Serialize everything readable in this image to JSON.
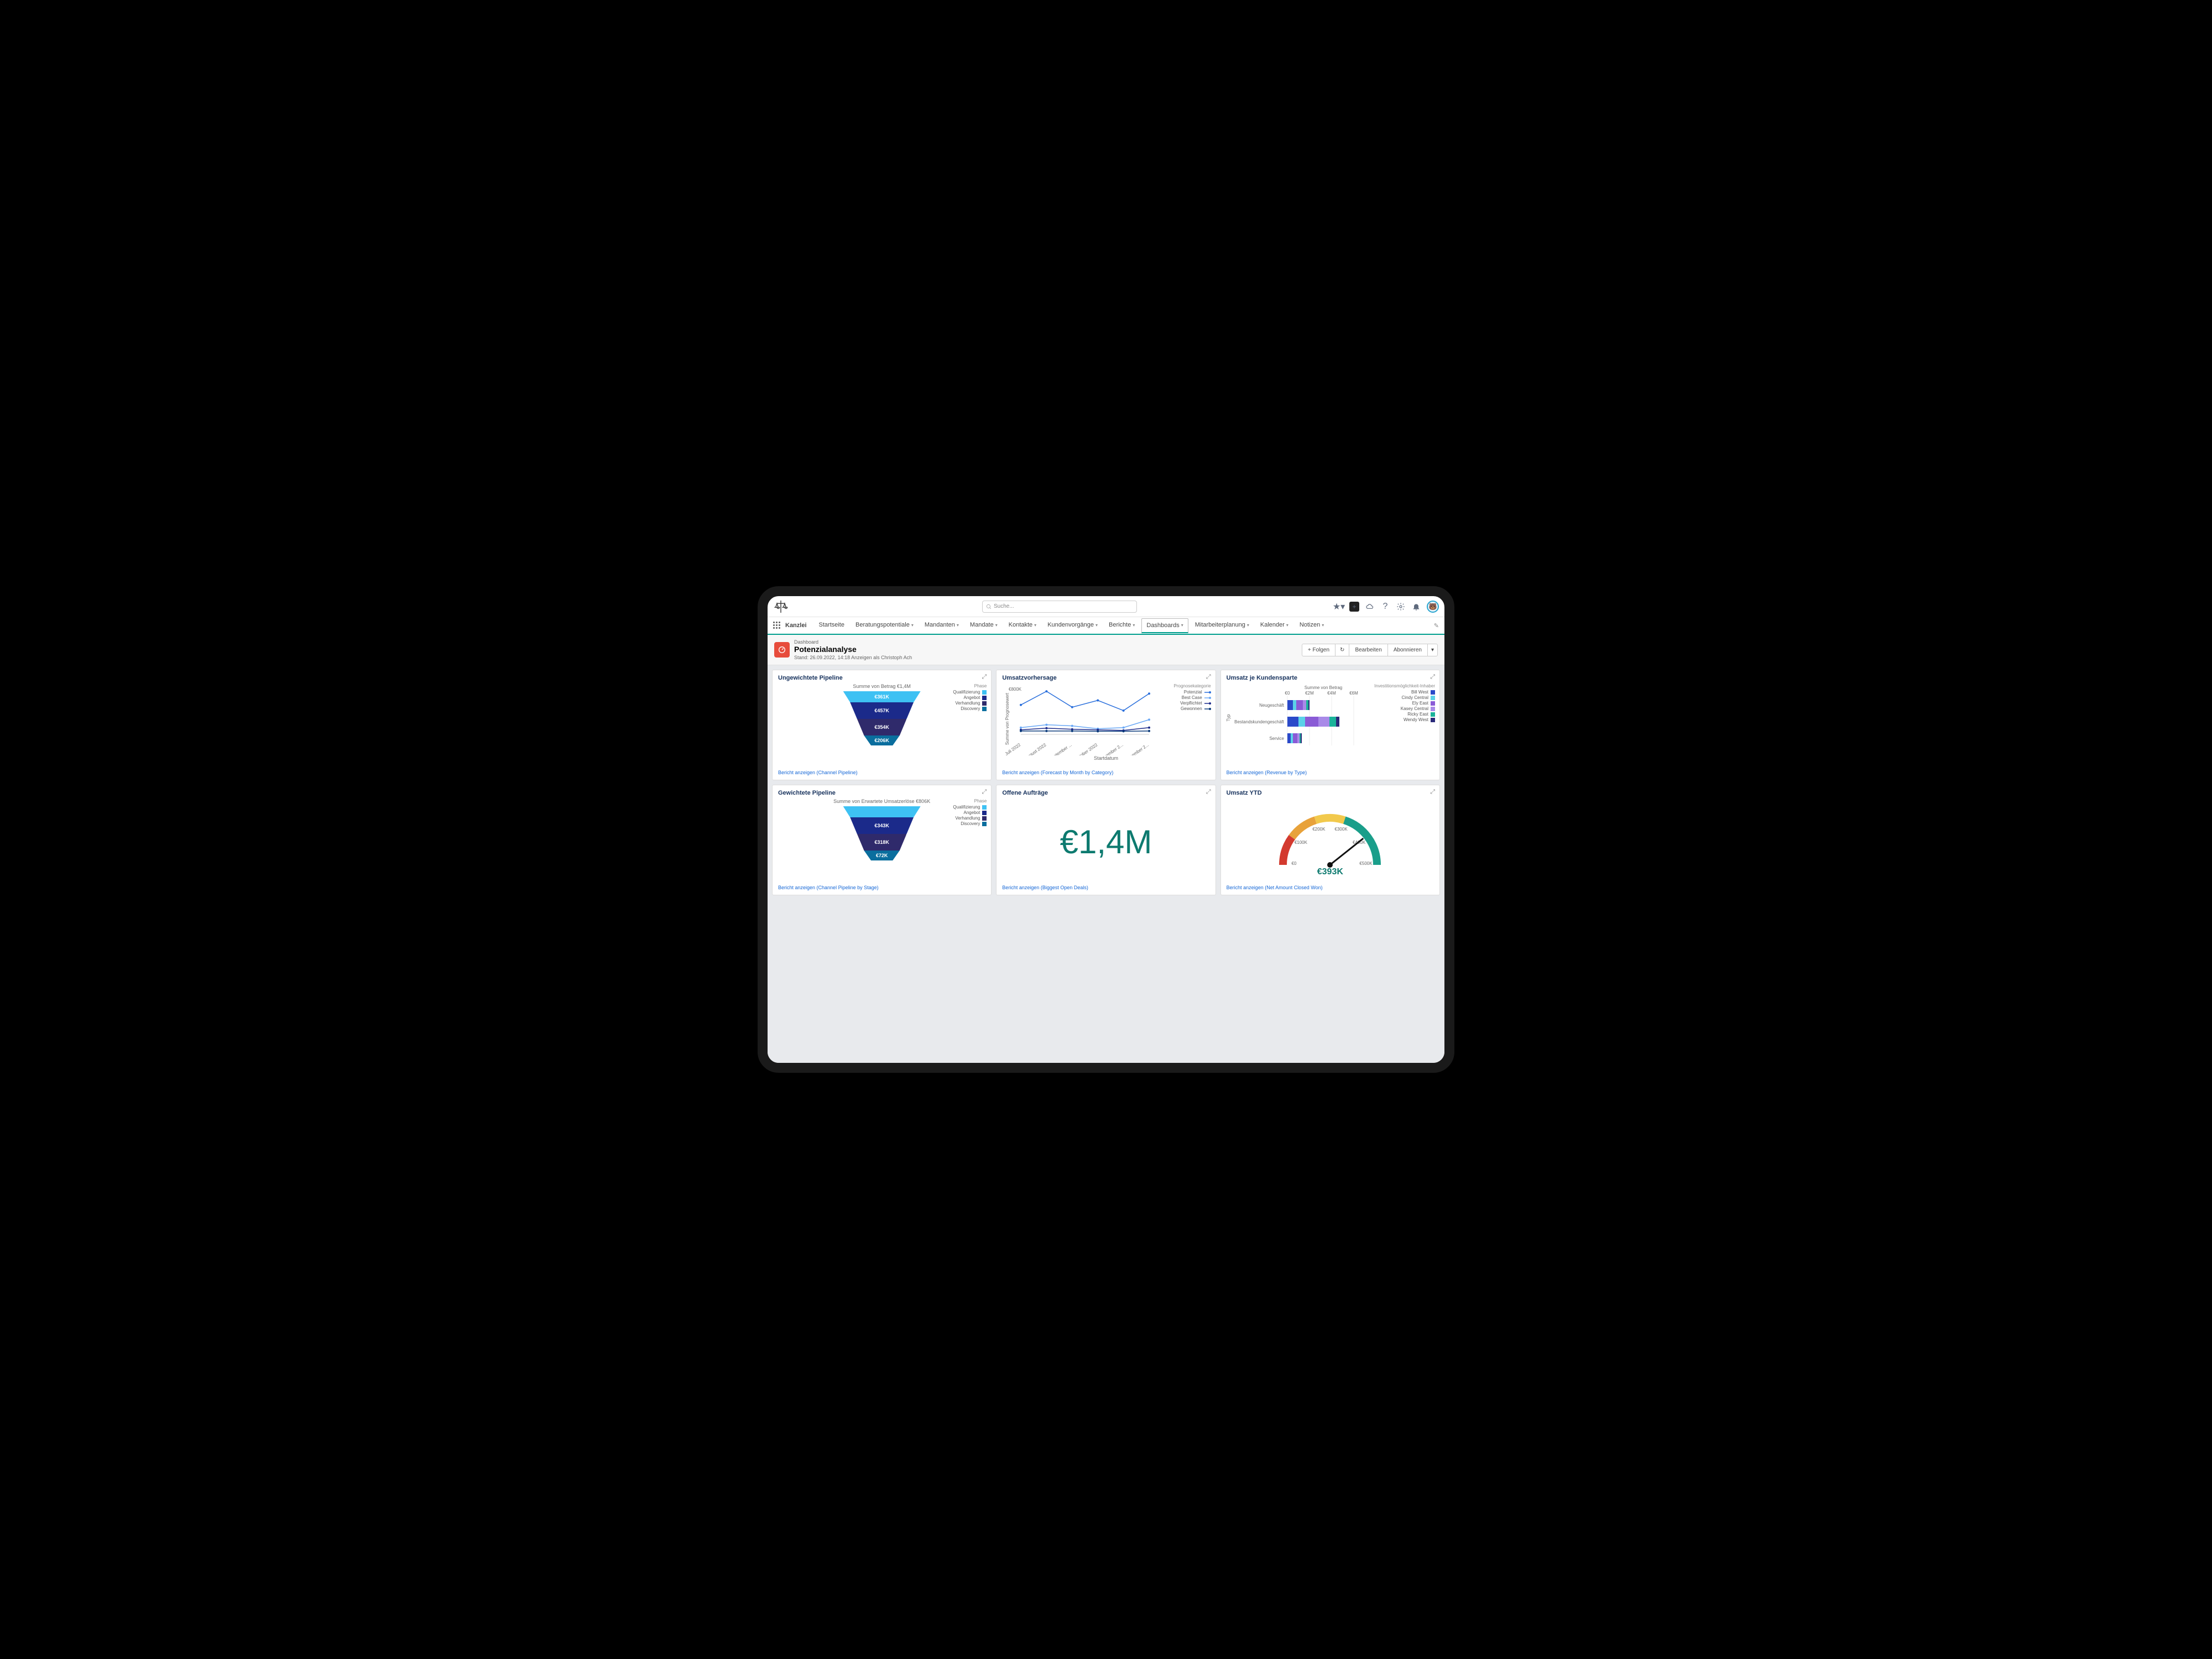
{
  "app_name": "Kanzlei",
  "search_placeholder": "Suche...",
  "nav": [
    "Startseite",
    "Beratungspotentiale",
    "Mandanten",
    "Mandate",
    "Kontakte",
    "Kundenvorgänge",
    "Berichte",
    "Dashboards",
    "Mitarbeiterplanung",
    "Kalender",
    "Notizen"
  ],
  "nav_active": "Dashboards",
  "header": {
    "eyebrow": "Dashboard",
    "title": "Potenzialanalyse",
    "sub": "Stand: 26.09.2022, 14:18 Anzeigen als Christoph Ach",
    "actions": [
      "+ Folgen",
      "Aktualisieren",
      "Bearbeiten",
      "Abonnieren",
      "▾"
    ]
  },
  "cards": {
    "c1": {
      "title": "Ungewichtete Pipeline",
      "sub": "Summe von Betrag €1,4M",
      "legend_hdr": "Phase",
      "legend": [
        [
          "Qualifizierung",
          "#3ec1f3"
        ],
        [
          "Angebot",
          "#1b2a8a"
        ],
        [
          "Verhandlung",
          "#2f2a6b"
        ],
        [
          "Discovery",
          "#0a6e9e"
        ]
      ],
      "link": "Bericht anzeigen (Channel Pipeline)"
    },
    "c2": {
      "title": "Umsatzvorhersage",
      "ylabel": "Summe von Prognosewert",
      "xlabel": "Startdatum",
      "legend_hdr": "Prognosekategorie",
      "legend": [
        [
          "Potenzial",
          "#2a6fdc"
        ],
        [
          "Best Case",
          "#6aa8f5"
        ],
        [
          "Verpflichtet",
          "#1b2a8a"
        ],
        [
          "Gewonnen",
          "#0a3a7a"
        ]
      ],
      "link": "Bericht anzeigen (Forecast by Month by Category)"
    },
    "c3": {
      "title": "Umsatz je Kundensparte",
      "axis_title": "Summe von Betrag",
      "ylabel": "Typ",
      "legend_hdr": "Investitionsmöglichkeit-Inhaber",
      "legend": [
        [
          "Bill West",
          "#2a49c9"
        ],
        [
          "Cindy Central",
          "#5bd1e8"
        ],
        [
          "Ely East",
          "#8a5bd6"
        ],
        [
          "Kasey Central",
          "#a98ae8"
        ],
        [
          "Ricky East",
          "#1bb39a"
        ],
        [
          "Wendy West",
          "#2a2a7a"
        ]
      ],
      "cats": [
        "Neugeschäft",
        "Bestandskundengeschäft",
        "Service"
      ],
      "ticks": [
        "€0",
        "€2M",
        "€4M",
        "€6M"
      ],
      "link": "Bericht anzeigen (Revenue by Type)"
    },
    "c4": {
      "title": "Gewichtete Pipeline",
      "sub": "Summe von Erwartete Umsatzerlöse €806K",
      "legend_hdr": "Phase",
      "legend": [
        [
          "Qualifizierung",
          "#3ec1f3"
        ],
        [
          "Angebot",
          "#1b2a8a"
        ],
        [
          "Verhandlung",
          "#2f2a6b"
        ],
        [
          "Discovery",
          "#0a6e9e"
        ]
      ],
      "link": "Bericht anzeigen (Channel Pipeline by Stage)"
    },
    "c5": {
      "title": "Offene Aufträge",
      "metric": "€1,4M",
      "link": "Bericht anzeigen (Biggest Open Deals)"
    },
    "c6": {
      "title": "Umsatz YTD",
      "value": "€393K",
      "ticks": [
        "€0",
        "€100K",
        "€200K",
        "€300K",
        "€400K",
        "€500K"
      ],
      "link": "Bericht anzeigen (Net Amount Closed Won)"
    }
  },
  "chart_data": [
    {
      "type": "funnel",
      "title": "Ungewichtete Pipeline",
      "series": [
        {
          "label": "€361K",
          "value": 361,
          "color": "#3ec1f3"
        },
        {
          "label": "€457K",
          "value": 457,
          "color": "#1b2a8a"
        },
        {
          "label": "€354K",
          "value": 354,
          "color": "#2f2a6b"
        },
        {
          "label": "€206K",
          "value": 206,
          "color": "#0a6e9e"
        }
      ]
    },
    {
      "type": "line",
      "title": "Umsatzvorhersage",
      "xlabel": "Startdatum",
      "ylabel": "Summe von Prognosewert",
      "categories": [
        "Juli 2022",
        "August 2022",
        "September ...",
        "Oktober 2022",
        "November 2...",
        "Dezember 2..."
      ],
      "ylim": [
        0,
        800
      ],
      "yticks": [
        "€800K"
      ],
      "series": [
        {
          "name": "Potenzial",
          "values": [
            520,
            760,
            480,
            600,
            420,
            720
          ],
          "color": "#2a6fdc"
        },
        {
          "name": "Best Case",
          "values": [
            120,
            170,
            150,
            100,
            120,
            260
          ],
          "color": "#6aa8f5"
        },
        {
          "name": "Verpflichtet",
          "values": [
            80,
            110,
            90,
            80,
            70,
            120
          ],
          "color": "#1b2a8a"
        },
        {
          "name": "Gewonnen",
          "values": [
            60,
            60,
            60,
            55,
            55,
            60
          ],
          "color": "#0a3a7a"
        }
      ]
    },
    {
      "type": "bar",
      "orientation": "horizontal",
      "stacked": true,
      "title": "Umsatz je Kundensparte",
      "xlabel": "Summe von Betrag",
      "categories": [
        "Neugeschäft",
        "Bestandskundengeschäft",
        "Service"
      ],
      "xlim": [
        0,
        6
      ],
      "xunit": "€M",
      "series": [
        {
          "name": "Bill West",
          "color": "#2a49c9",
          "values": [
            0.5,
            1.0,
            0.3
          ]
        },
        {
          "name": "Cindy Central",
          "color": "#5bd1e8",
          "values": [
            0.3,
            0.6,
            0.2
          ]
        },
        {
          "name": "Ely East",
          "color": "#8a5bd6",
          "values": [
            0.6,
            1.2,
            0.4
          ]
        },
        {
          "name": "Kasey Central",
          "color": "#a98ae8",
          "values": [
            0.3,
            1.0,
            0.2
          ]
        },
        {
          "name": "Ricky East",
          "color": "#1bb39a",
          "values": [
            0.2,
            0.6,
            0.1
          ]
        },
        {
          "name": "Wendy West",
          "color": "#2a2a7a",
          "values": [
            0.1,
            0.3,
            0.1
          ]
        }
      ]
    },
    {
      "type": "funnel",
      "title": "Gewichtete Pipeline",
      "series": [
        {
          "label": "",
          "value": 70,
          "color": "#3ec1f3"
        },
        {
          "label": "€343K",
          "value": 343,
          "color": "#1b2a8a"
        },
        {
          "label": "€318K",
          "value": 318,
          "color": "#2f2a6b"
        },
        {
          "label": "€72K",
          "value": 72,
          "color": "#0a6e9e"
        }
      ]
    },
    {
      "type": "gauge",
      "title": "Umsatz YTD",
      "value": 393,
      "min": 0,
      "max": 500,
      "unit": "€K",
      "segments": [
        {
          "to": 100,
          "color": "#d33a2f"
        },
        {
          "to": 200,
          "color": "#e8a23a"
        },
        {
          "to": 300,
          "color": "#f2c94c"
        },
        {
          "to": 500,
          "color": "#1a9e8a"
        }
      ]
    }
  ]
}
